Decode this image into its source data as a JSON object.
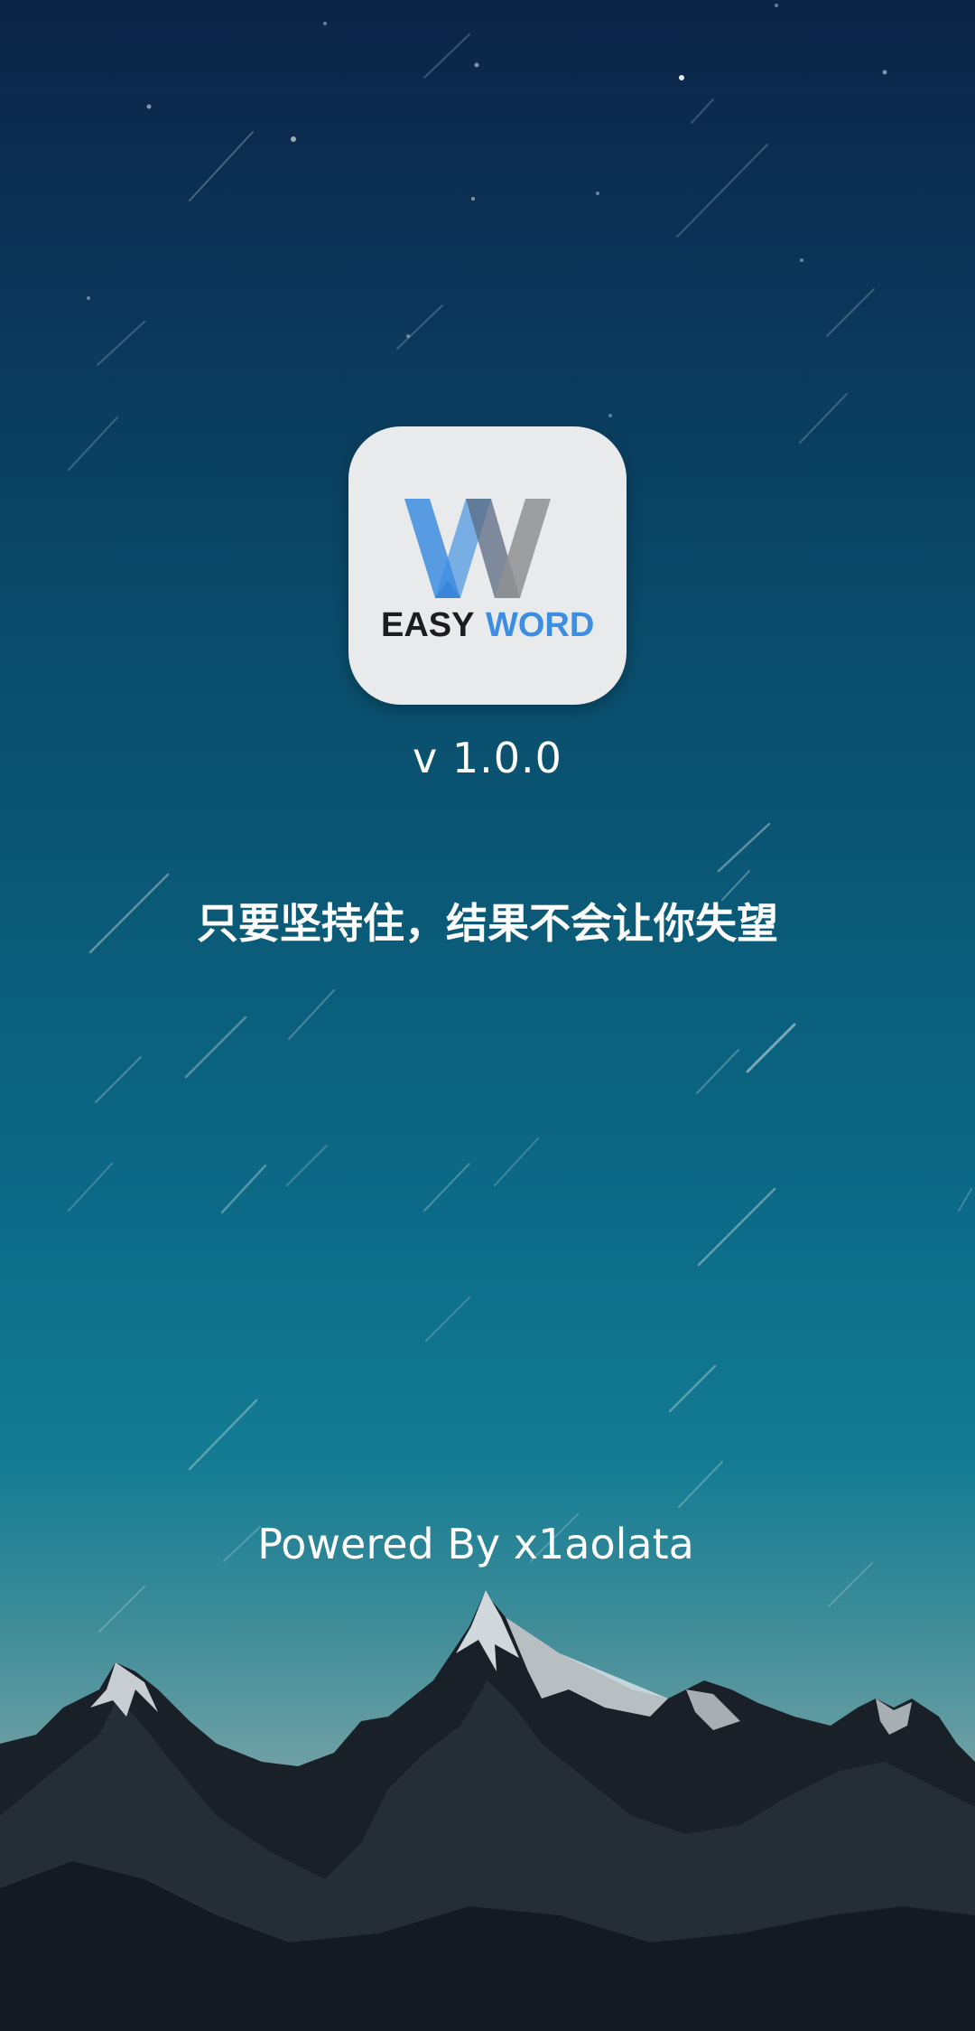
{
  "splash": {
    "logo": {
      "icon": "easy-word-logo-icon",
      "word_left": "EASY",
      "word_right": "WORD",
      "colors": {
        "tile": "#e9eaec",
        "blue": "#3d8de2",
        "gray": "#8f9092",
        "black": "#1d1d1f"
      }
    },
    "version": "v 1.0.0",
    "slogan": "只要坚持住，结果不会让你失望",
    "powered_by": "Powered By x1aolata"
  },
  "colors": {
    "bg_top": "#0b2447",
    "bg_bottom": "#86aeb0"
  }
}
